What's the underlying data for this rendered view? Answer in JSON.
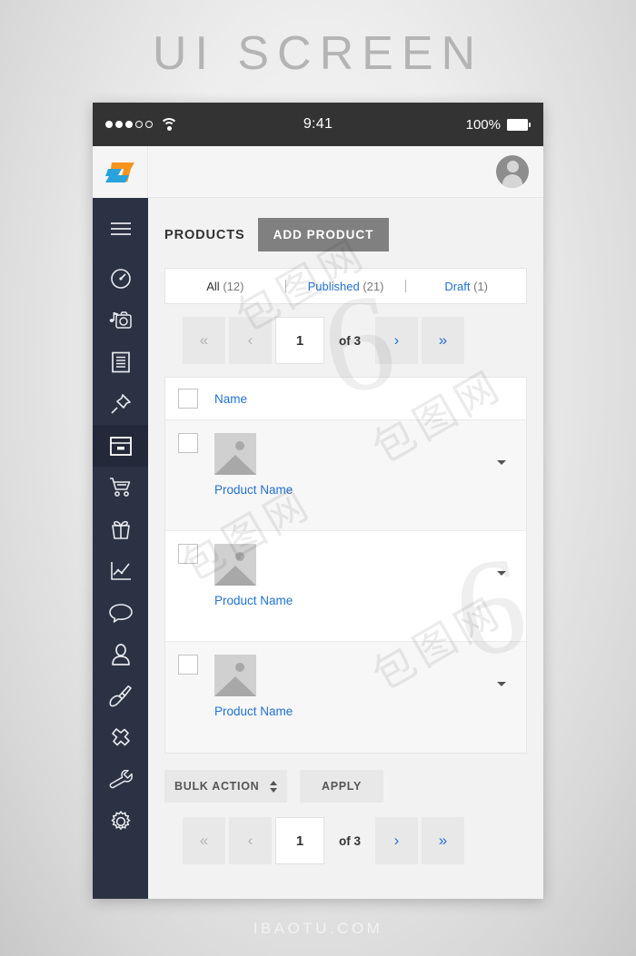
{
  "poster": {
    "title": "UI SCREEN",
    "footer": "IBAOTU.COM"
  },
  "statusbar": {
    "signal_dots_filled": 3,
    "signal_dots_empty": 2,
    "wifi_icon": "wifi-icon",
    "time": "9:41",
    "battery_percent": "100%",
    "battery_icon": "battery-full-icon"
  },
  "topbar": {
    "logo_alt": "brand-logo",
    "avatar_alt": "user-avatar"
  },
  "sidebar": {
    "items": [
      {
        "icon": "hamburger-menu-icon",
        "active": false
      },
      {
        "icon": "dashboard-gauge-icon",
        "active": false
      },
      {
        "icon": "media-camera-icon",
        "active": false
      },
      {
        "icon": "pages-document-icon",
        "active": false
      },
      {
        "icon": "pushpin-icon",
        "active": false
      },
      {
        "icon": "drawer-archive-icon",
        "active": true
      },
      {
        "icon": "shopping-cart-icon",
        "active": false
      },
      {
        "icon": "gift-box-icon",
        "active": false
      },
      {
        "icon": "analytics-chart-icon",
        "active": false
      },
      {
        "icon": "comment-bubble-icon",
        "active": false
      },
      {
        "icon": "user-profile-icon",
        "active": false
      },
      {
        "icon": "paintbrush-icon",
        "active": false
      },
      {
        "icon": "plugin-icon",
        "active": false
      },
      {
        "icon": "wrench-tools-icon",
        "active": false
      },
      {
        "icon": "settings-gear-icon",
        "active": false
      }
    ]
  },
  "page": {
    "title": "PRODUCTS",
    "add_button": "ADD PRODUCT"
  },
  "filters": {
    "tabs": [
      {
        "label": "All",
        "count": "(12)",
        "link": false
      },
      {
        "label": "Published",
        "count": "(21)",
        "link": true
      },
      {
        "label": "Draft",
        "count": "(1)",
        "link": true
      }
    ]
  },
  "pagination": {
    "first_label": "«",
    "prev_label": "‹",
    "current_page": "1",
    "of_label": "of 3",
    "next_label": "›",
    "last_label": "»",
    "first_enabled": false,
    "prev_enabled": false,
    "next_enabled": true,
    "last_enabled": true
  },
  "table": {
    "header": {
      "name_column": "Name"
    },
    "rows": [
      {
        "name": "Product Name",
        "thumb": "image-placeholder-icon",
        "shaded": true
      },
      {
        "name": "Product Name",
        "thumb": "image-placeholder-icon",
        "shaded": false
      },
      {
        "name": "Product Name",
        "thumb": "image-placeholder-icon",
        "shaded": true
      }
    ]
  },
  "bulk": {
    "select_label": "BULK ACTION",
    "apply_label": "APPLY"
  },
  "colors": {
    "sidebar_bg": "#2b3243",
    "sidebar_active": "#232939",
    "statusbar_bg": "#333333",
    "link_blue": "#2272cf",
    "add_button_bg": "#808080",
    "content_bg": "#f2f2f2",
    "logo_orange": "#f7941e",
    "logo_blue": "#29a3dc"
  },
  "watermarks": [
    "包图网",
    "包图网",
    "包图网",
    "包图网"
  ]
}
